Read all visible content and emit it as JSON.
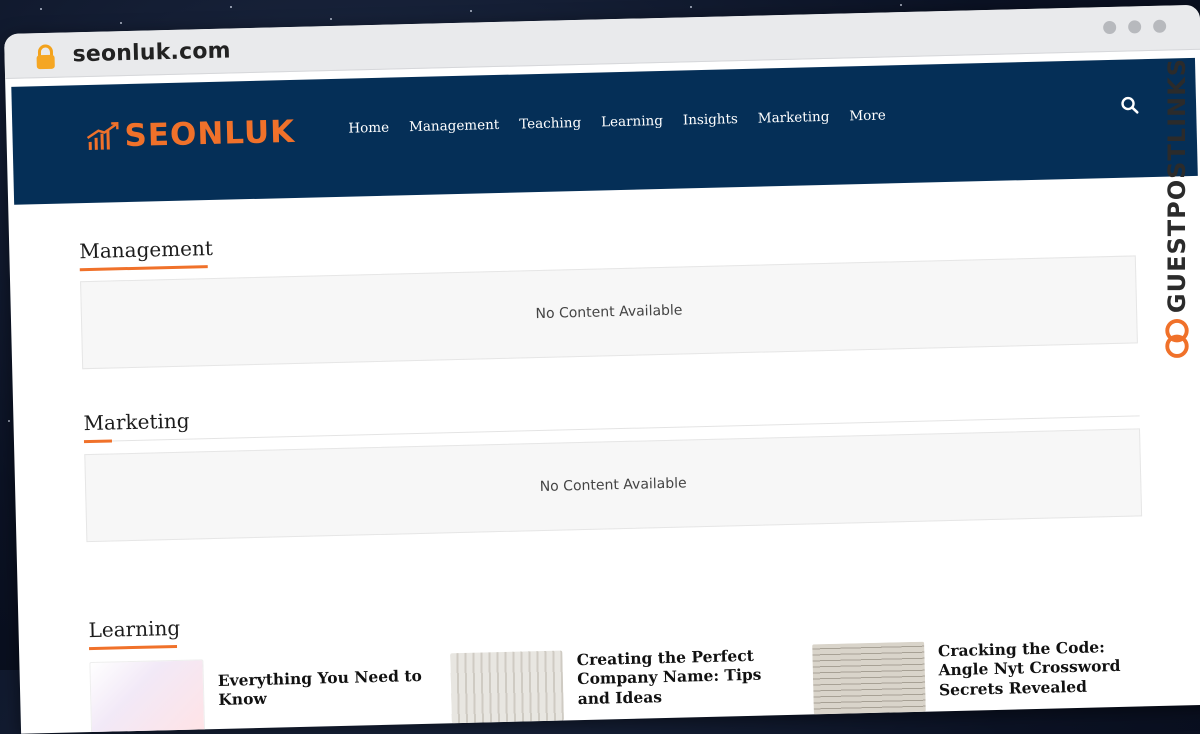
{
  "browser": {
    "url": "seonluk.com"
  },
  "site": {
    "logo_text": "SEONLUK",
    "brand_color": "#f0712a",
    "nav_bg": "#052f57"
  },
  "nav": {
    "items": [
      {
        "label": "Home"
      },
      {
        "label": "Management"
      },
      {
        "label": "Teaching"
      },
      {
        "label": "Learning"
      },
      {
        "label": "Insights"
      },
      {
        "label": "Marketing"
      },
      {
        "label": "More"
      }
    ],
    "search_icon": "search-icon"
  },
  "sections": {
    "management": {
      "title": "Management",
      "empty_text": "No Content Available"
    },
    "marketing": {
      "title": "Marketing",
      "empty_text": "No Content Available"
    },
    "learning": {
      "title": "Learning",
      "cards": [
        {
          "title": "Everything You Need to Know"
        },
        {
          "title": "Creating the Perfect Company Name: Tips and Ideas"
        },
        {
          "title": "Cracking the Code: Angle Nyt Crossword Secrets Revealed"
        }
      ]
    }
  },
  "watermark": {
    "text": "GUESTPOSTLINKS"
  }
}
